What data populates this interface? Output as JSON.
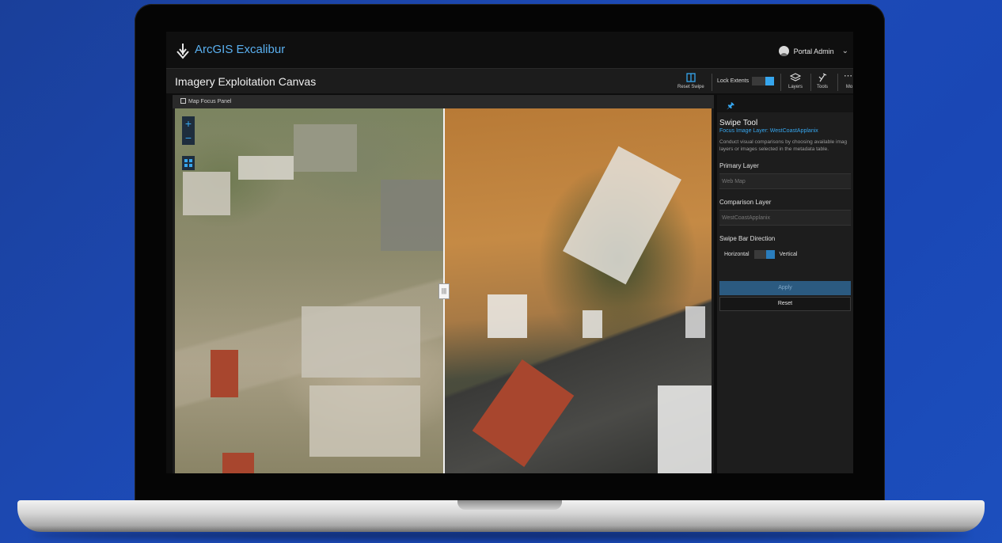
{
  "app": {
    "brand": "ArcGIS Excalibur",
    "user_name": "Portal Admin"
  },
  "canvas": {
    "title": "Imagery Exploitation Canvas",
    "panel_label": "Map Focus Panel"
  },
  "toolbar": {
    "reset_swipe": "Reset Swipe",
    "lock_extents": "Lock Extents",
    "lock_extents_on": true,
    "layers": "Layers",
    "tools": "Tools",
    "more": "Mo"
  },
  "swipe_tool": {
    "title": "Swipe Tool",
    "focus_layer": "Focus Image Layer: WestCoastApplanix",
    "desc_line1": "Conduct visual comparisons by choosing available imag",
    "desc_line2": "layers or images selected in the metadata table.",
    "primary_label": "Primary Layer",
    "primary_value": "Web Map",
    "comparison_label": "Comparison Layer",
    "comparison_value": "WestCoastApplanix",
    "direction_label": "Swipe Bar Direction",
    "horizontal": "Horizontal",
    "vertical": "Vertical",
    "direction_selected": "Vertical",
    "apply": "Apply",
    "reset": "Reset"
  },
  "colors": {
    "accent": "#36a6ee",
    "background": "#1d4bb8"
  },
  "icons": [
    "excalibur-logo-icon",
    "avatar-icon",
    "chevron-down-icon",
    "reset-swipe-icon",
    "layers-icon",
    "tools-icon",
    "more-icon",
    "zoom-in-icon",
    "zoom-out-icon",
    "grid-icon",
    "pin-icon",
    "checkbox-icon",
    "swipe-handle-icon"
  ]
}
